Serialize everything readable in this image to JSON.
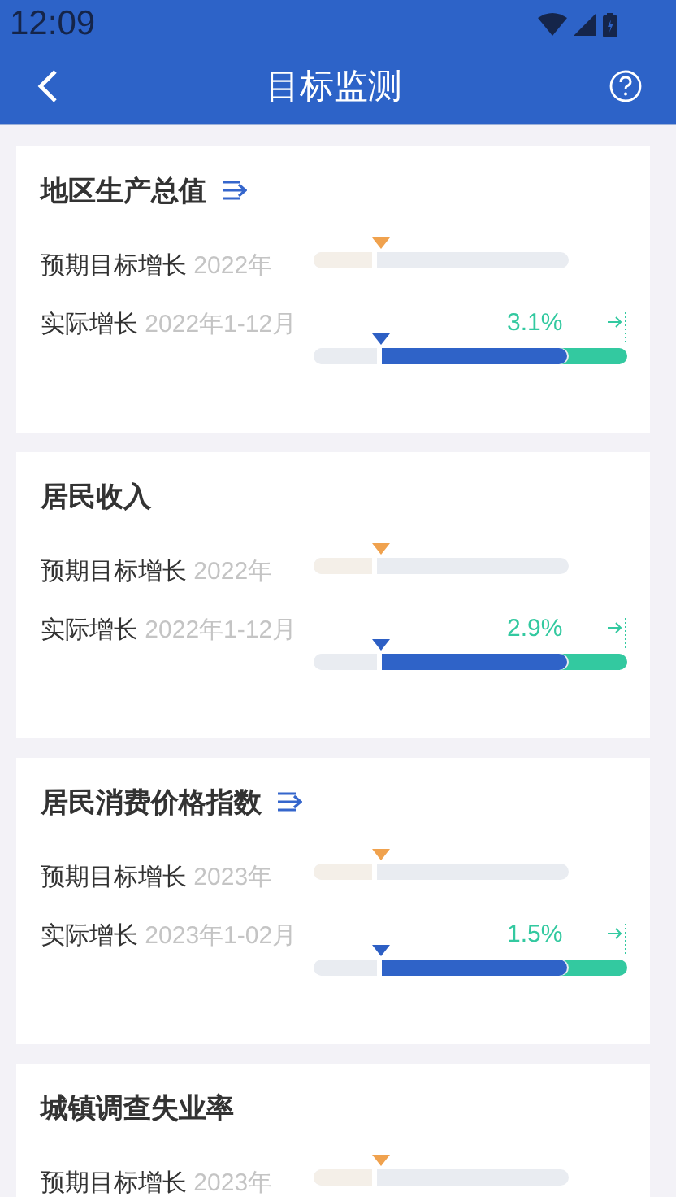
{
  "status_bar": {
    "time": "12:09"
  },
  "header": {
    "title": "目标监测"
  },
  "cards": [
    {
      "title": "地区生产总值",
      "linked": true,
      "target": {
        "label": "预期目标增长",
        "period": "2022年",
        "level": 0.25
      },
      "actual": {
        "label": "实际增长",
        "period": "2022年1-12月",
        "value": "3.1%",
        "level": 0.81
      }
    },
    {
      "title": "居民收入",
      "linked": false,
      "target": {
        "label": "预期目标增长",
        "period": "2022年",
        "level": 0.25
      },
      "actual": {
        "label": "实际增长",
        "period": "2022年1-12月",
        "value": "2.9%",
        "level": 0.81
      }
    },
    {
      "title": "居民消费价格指数",
      "linked": true,
      "target": {
        "label": "预期目标增长",
        "period": "2023年",
        "level": 0.25
      },
      "actual": {
        "label": "实际增长",
        "period": "2023年1-02月",
        "value": "1.5%",
        "level": 0.81
      }
    },
    {
      "title": "城镇调查失业率",
      "linked": false,
      "target": {
        "label": "预期目标增长",
        "period": "2023年",
        "level": 0.25
      }
    }
  ]
}
